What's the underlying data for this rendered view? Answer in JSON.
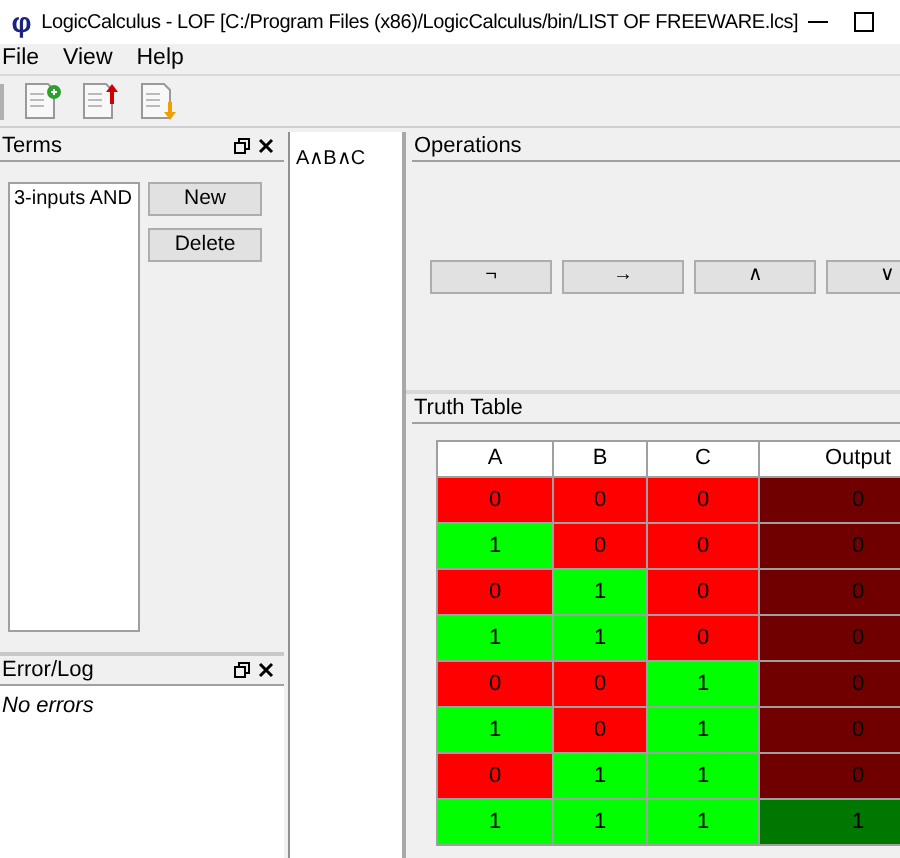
{
  "window": {
    "app_glyph": "φ",
    "title": "LogicCalculus - LOF [C:/Program Files (x86)/LogicCalculus/bin/LIST OF FREEWARE.lcs]"
  },
  "menu": [
    "File",
    "View",
    "Help"
  ],
  "terms_panel": {
    "title": "Terms",
    "items": [
      {
        "label": "3-inputs AND",
        "selected": false
      }
    ],
    "buttons": [
      "New",
      "Delete"
    ]
  },
  "log_panel": {
    "title": "Error/Log",
    "message": "No errors"
  },
  "expression": "A∧B∧C",
  "operations_panel": {
    "title": "Operations",
    "buttons": [
      "¬",
      "→",
      "∧",
      "∨"
    ]
  },
  "truth_table": {
    "title": "Truth Table",
    "columns": [
      {
        "label": "A",
        "kind": "input"
      },
      {
        "label": "B",
        "kind": "input"
      },
      {
        "label": "C",
        "kind": "input"
      },
      {
        "label": "Output",
        "kind": "output"
      }
    ],
    "rows": [
      [
        {
          "value": "0",
          "on": false
        },
        {
          "value": "0",
          "on": false
        },
        {
          "value": "0",
          "on": false
        },
        {
          "value": "0",
          "on": false
        }
      ],
      [
        {
          "value": "1",
          "on": true
        },
        {
          "value": "0",
          "on": false
        },
        {
          "value": "0",
          "on": false
        },
        {
          "value": "0",
          "on": false
        }
      ],
      [
        {
          "value": "0",
          "on": false
        },
        {
          "value": "1",
          "on": true
        },
        {
          "value": "0",
          "on": false
        },
        {
          "value": "0",
          "on": false
        }
      ],
      [
        {
          "value": "1",
          "on": true
        },
        {
          "value": "1",
          "on": true
        },
        {
          "value": "0",
          "on": false
        },
        {
          "value": "0",
          "on": false
        }
      ],
      [
        {
          "value": "0",
          "on": false
        },
        {
          "value": "0",
          "on": false
        },
        {
          "value": "1",
          "on": true
        },
        {
          "value": "0",
          "on": false
        }
      ],
      [
        {
          "value": "1",
          "on": true
        },
        {
          "value": "0",
          "on": false
        },
        {
          "value": "1",
          "on": true
        },
        {
          "value": "0",
          "on": false
        }
      ],
      [
        {
          "value": "0",
          "on": false
        },
        {
          "value": "1",
          "on": true
        },
        {
          "value": "1",
          "on": true
        },
        {
          "value": "0",
          "on": false
        }
      ],
      [
        {
          "value": "1",
          "on": true
        },
        {
          "value": "1",
          "on": true
        },
        {
          "value": "1",
          "on": true
        },
        {
          "value": "1",
          "on": true
        }
      ]
    ]
  }
}
